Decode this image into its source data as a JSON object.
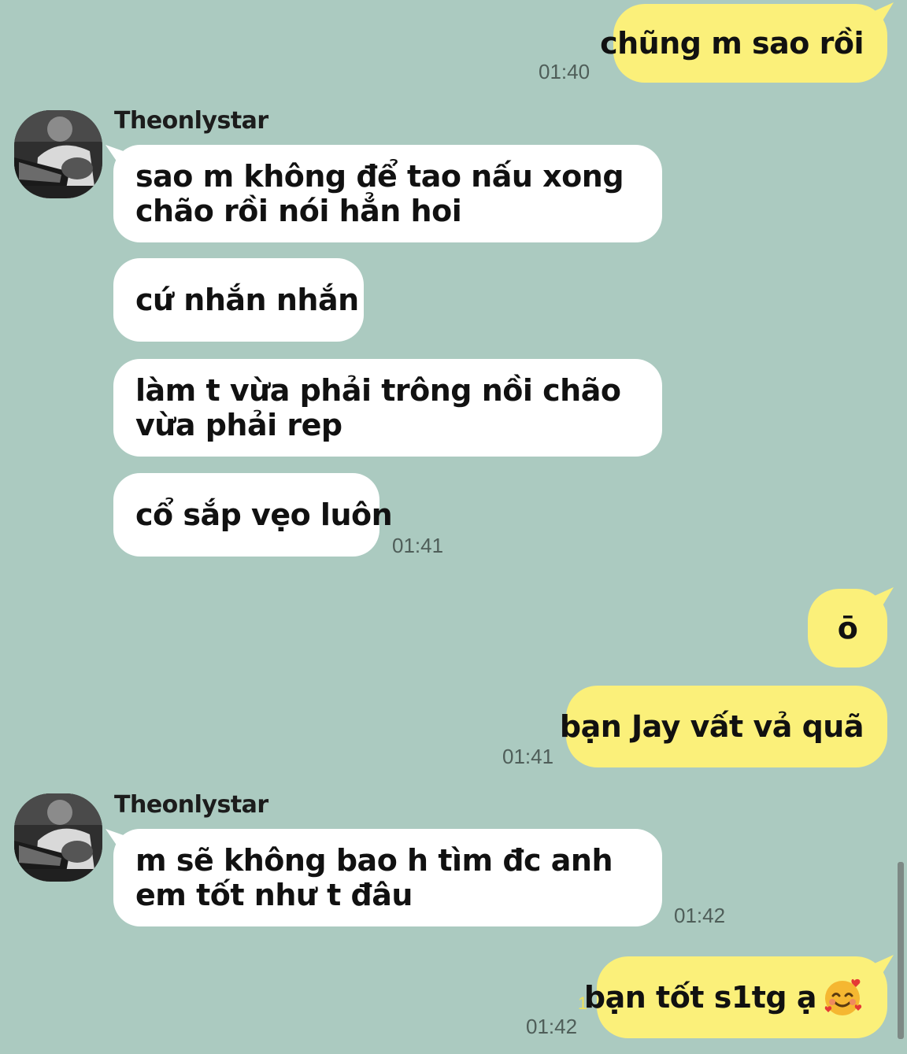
{
  "messages": [
    {
      "text": "chũng m sao rồi",
      "time": "01:40"
    },
    {
      "sender": "Theonlystar",
      "text": "sao m không để tao nấu xong chão rồi nói hẳn hoi"
    },
    {
      "text": "cứ nhắn nhắn"
    },
    {
      "text": "làm t vừa phải trông nồi chão vừa phải rep"
    },
    {
      "text": "cổ sắp vẹo luôn",
      "time": "01:41"
    },
    {
      "text": "ō"
    },
    {
      "text": "bạn Jay vất vả quã",
      "time": "01:41"
    },
    {
      "sender": "Theonlystar",
      "text": "m sẽ không bao h tìm đc anh em tốt như t đâu",
      "time": "01:42"
    },
    {
      "text": "bạn tốt s1tg ạ",
      "time": "01:42",
      "unread": "1",
      "emoji": "smiling-face-with-hearts"
    }
  ],
  "colors": {
    "background": "#abcac0",
    "incoming_bubble": "#ffffff",
    "outgoing_bubble": "#fbf07a",
    "timestamp": "#4f5e59"
  }
}
